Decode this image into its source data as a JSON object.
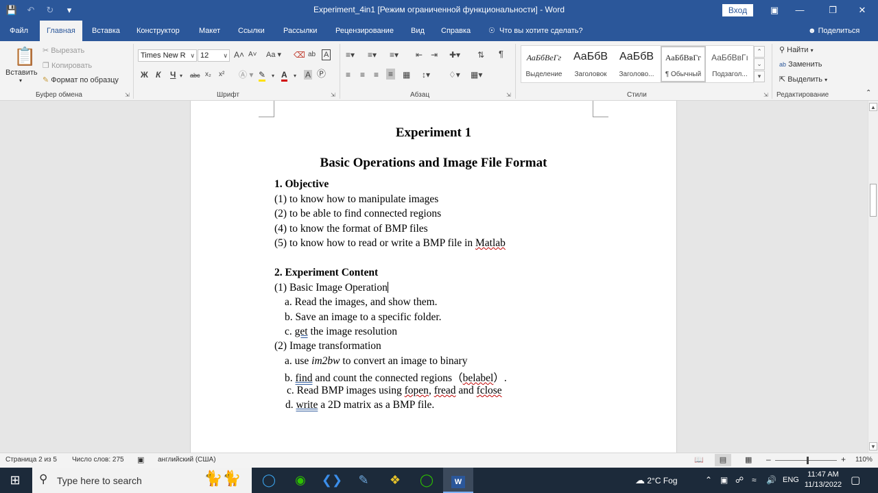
{
  "titlebar": {
    "title": "Experiment_4in1 [Режим ограниченной функциональности]  -  Word",
    "login_label": "Вход"
  },
  "tabs": [
    "Файл",
    "Главная",
    "Вставка",
    "Конструктор",
    "Макет",
    "Ссылки",
    "Рассылки",
    "Рецензирование",
    "Вид",
    "Справка"
  ],
  "tell_me": "Что вы хотите сделать?",
  "share": "Поделиться",
  "ribbon": {
    "clipboard": {
      "paste": "Вставить",
      "cut": "Вырезать",
      "copy": "Копировать",
      "format_painter": "Формат по образцу",
      "group": "Буфер обмена"
    },
    "font": {
      "name": "Times New R",
      "size": "12",
      "group": "Шрифт",
      "bold": "Ж",
      "italic": "К",
      "underline": "Ч",
      "strike": "abc",
      "subscript": "x₂",
      "superscript": "x²",
      "grow": "A˄",
      "shrink": "A˅",
      "case": "Aa"
    },
    "paragraph": {
      "group": "Абзац"
    },
    "styles": {
      "group": "Стили",
      "items": [
        {
          "preview": "АаБбВеГг",
          "name": "Выделение"
        },
        {
          "preview": "АаБбВ",
          "name": "Заголовок"
        },
        {
          "preview": "АаБбВ",
          "name": "Заголово..."
        },
        {
          "preview": "АаБбВвГг",
          "name": "¶ Обычный"
        },
        {
          "preview": "АаБбВвГı",
          "name": "Подзагол..."
        }
      ]
    },
    "editing": {
      "group": "Редактирование",
      "find": "Найти",
      "replace": "Заменить",
      "select": "Выделить"
    }
  },
  "document": {
    "title": "Experiment 1",
    "subtitle": "Basic Operations and Image File Format",
    "objective_heading": "1. Objective",
    "objectives": [
      "(1) to know how to manipulate images",
      "(2) to be able to find connected regions",
      "(4) to know the format of BMP files",
      "(5) to know how to read or write a BMP file in "
    ],
    "objective_last_word": "Matlab",
    "content_heading": "2. Experiment Content",
    "basic_op": "(1) Basic Image Operation",
    "basic_items": [
      "a. Read the images, and show them.",
      "b. Save an image to a specific folder."
    ],
    "basic_c_prefix": "c. ",
    "basic_c_word": "get",
    "basic_c_rest": " the image resolution",
    "transform": "(2) Image transformation",
    "t_a_prefix": "a. use ",
    "t_a_fn": "im2bw",
    "t_a_rest": " to convert an image to binary",
    "t_b_prefix": "b. ",
    "t_b_word": "find",
    "t_b_mid": " and count the connected regions（",
    "t_b_fn": "belabel",
    "t_b_end": "）.",
    "t_c_prefix": "c. Read BMP images using ",
    "t_c_f1": "fopen",
    "t_c_sep1": ", ",
    "t_c_f2": "fread",
    "t_c_sep2": " and ",
    "t_c_f3": "fclose",
    "t_d_prefix": "d. ",
    "t_d_word": "write",
    "t_d_rest": " a 2D matrix as a BMP file."
  },
  "statusbar": {
    "page": "Страница 2 из 5",
    "words": "Число слов: 275",
    "language": "английский (США)",
    "zoom": "110%"
  },
  "taskbar": {
    "search_placeholder": "Type here to search",
    "weather": "2°C  Fog",
    "lang": "ENG",
    "time": "11:47 AM",
    "date": "11/13/2022"
  },
  "colors": {
    "word_blue": "#2b579a",
    "ribbon_bg": "#f3f3f3",
    "taskbar": "#1c2a3a"
  }
}
